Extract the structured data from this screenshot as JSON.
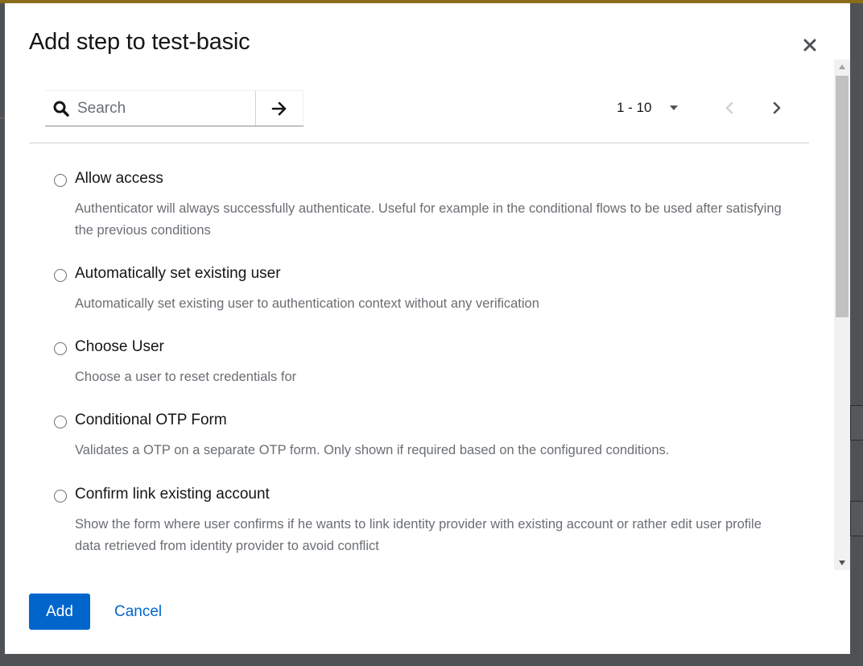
{
  "modal": {
    "title": "Add step to test-basic",
    "close_icon": "close-icon"
  },
  "search": {
    "placeholder": "Search",
    "value": "",
    "icon": "search-icon",
    "submit_icon": "arrow-right-icon"
  },
  "pagination": {
    "range": "1 - 10",
    "toggle_icon": "caret-down-icon",
    "prev_icon": "angle-left-icon",
    "next_icon": "angle-right-icon",
    "prev_disabled": true
  },
  "items": [
    {
      "label": "Allow access",
      "description": "Authenticator will always successfully authenticate. Useful for example in the conditional flows to be used after satisfying the previous conditions",
      "selected": false
    },
    {
      "label": "Automatically set existing user",
      "description": "Automatically set existing user to authentication context without any verification",
      "selected": false
    },
    {
      "label": "Choose User",
      "description": "Choose a user to reset credentials for",
      "selected": false
    },
    {
      "label": "Conditional OTP Form",
      "description": "Validates a OTP on a separate OTP form. Only shown if required based on the configured conditions.",
      "selected": false
    },
    {
      "label": "Confirm link existing account",
      "description": "Show the form where user confirms if he wants to link identity provider with existing account or rather edit user profile data retrieved from identity provider to avoid conflict",
      "selected": false
    }
  ],
  "footer": {
    "add_label": "Add",
    "cancel_label": "Cancel"
  },
  "colors": {
    "primary": "#0066cc",
    "text": "#151515",
    "muted": "#6a6e73"
  }
}
